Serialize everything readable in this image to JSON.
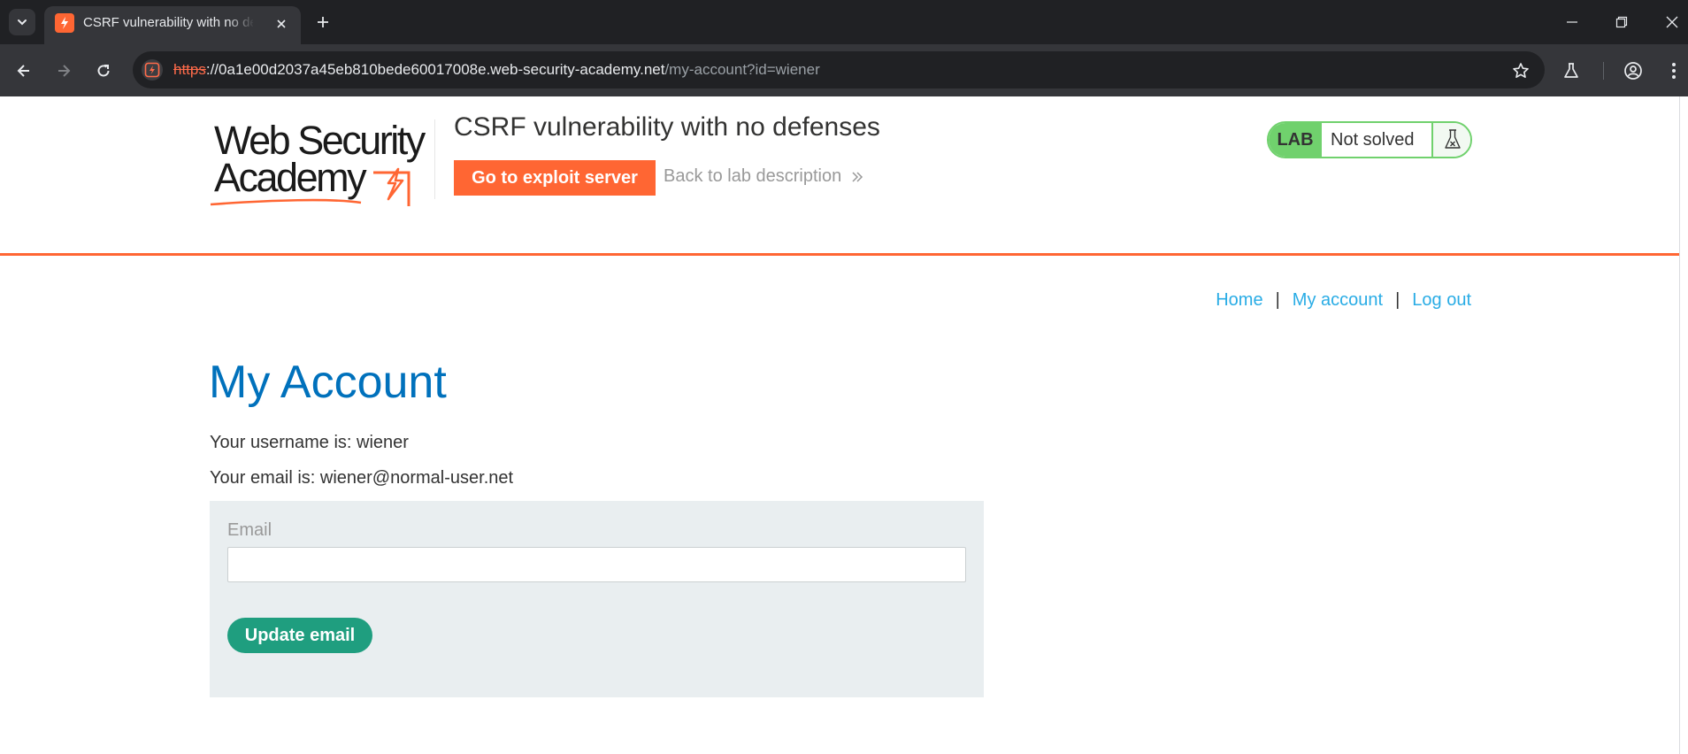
{
  "browser": {
    "tab": {
      "title": "CSRF vulnerability with no defenses",
      "favicon": "lightning-favicon-icon"
    },
    "url": {
      "scheme": "https",
      "separator": "://",
      "host": "0a1e00d2037a45eb810bede60017008e.web-security-academy.net",
      "path": "/my-account?id=wiener"
    },
    "colors": {
      "tabbar_bg": "#202124",
      "toolbar_bg": "#35363a",
      "insecure_scheme": "#ff6b4a"
    }
  },
  "header": {
    "logo": {
      "line1": "Web Security",
      "line2": "Academy"
    },
    "lab_title": "CSRF vulnerability with no defenses",
    "exploit_button": "Go to exploit server",
    "back_link": "Back to lab description",
    "lab_status": {
      "badge": "LAB",
      "status": "Not solved"
    },
    "colors": {
      "accent": "#ff6633",
      "lab_green": "#70d16d"
    }
  },
  "nav": {
    "links": [
      "Home",
      "My account",
      "Log out"
    ],
    "separator": "|"
  },
  "main": {
    "heading": "My Account",
    "username_line": "Your username is: wiener",
    "email_line": "Your email is: wiener@normal-user.net",
    "form": {
      "email_label": "Email",
      "email_value": "",
      "submit_label": "Update email"
    },
    "colors": {
      "heading": "#0071bc",
      "link": "#29ace5",
      "form_bg": "#e9eef0",
      "button": "#1f9e7f"
    }
  }
}
